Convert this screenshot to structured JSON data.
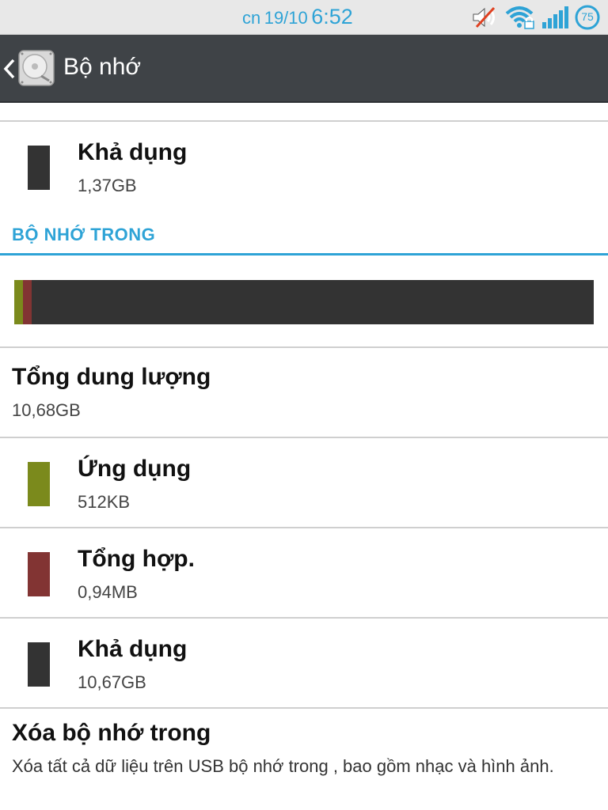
{
  "status_bar": {
    "day": "cn",
    "date": "19/10",
    "time": "6:52",
    "battery": "75",
    "icons": [
      "volume-muted-icon",
      "wifi-lock-icon",
      "signal-icon",
      "battery-icon"
    ]
  },
  "action_bar": {
    "title": "Bộ nhớ",
    "back_icon": "chevron-left-icon",
    "app_icon": "storage-disk-icon"
  },
  "top_item": {
    "title": "Khả dụng",
    "value": "1,37GB",
    "color": "#333333"
  },
  "internal_storage": {
    "section_header": "BỘ NHỚ TRONG",
    "accent": "#2ea3d6",
    "usage_fractions": {
      "apps": 0.015,
      "misc": 0.015,
      "available": 0.97
    },
    "total": {
      "title": "Tổng dung lượng",
      "value": "10,68GB"
    },
    "items": [
      {
        "title": "Ứng dụng",
        "value": "512KB",
        "color": "#7b8a1c"
      },
      {
        "title": "Tổng hợp.",
        "value": "0,94MB",
        "color": "#823433"
      },
      {
        "title": "Khả dụng",
        "value": "10,67GB",
        "color": "#333333"
      }
    ]
  },
  "erase": {
    "title": "Xóa bộ nhớ trong",
    "description": "Xóa tất cả dữ liệu trên USB bộ nhớ trong , bao gồm nhạc và hình ảnh."
  }
}
